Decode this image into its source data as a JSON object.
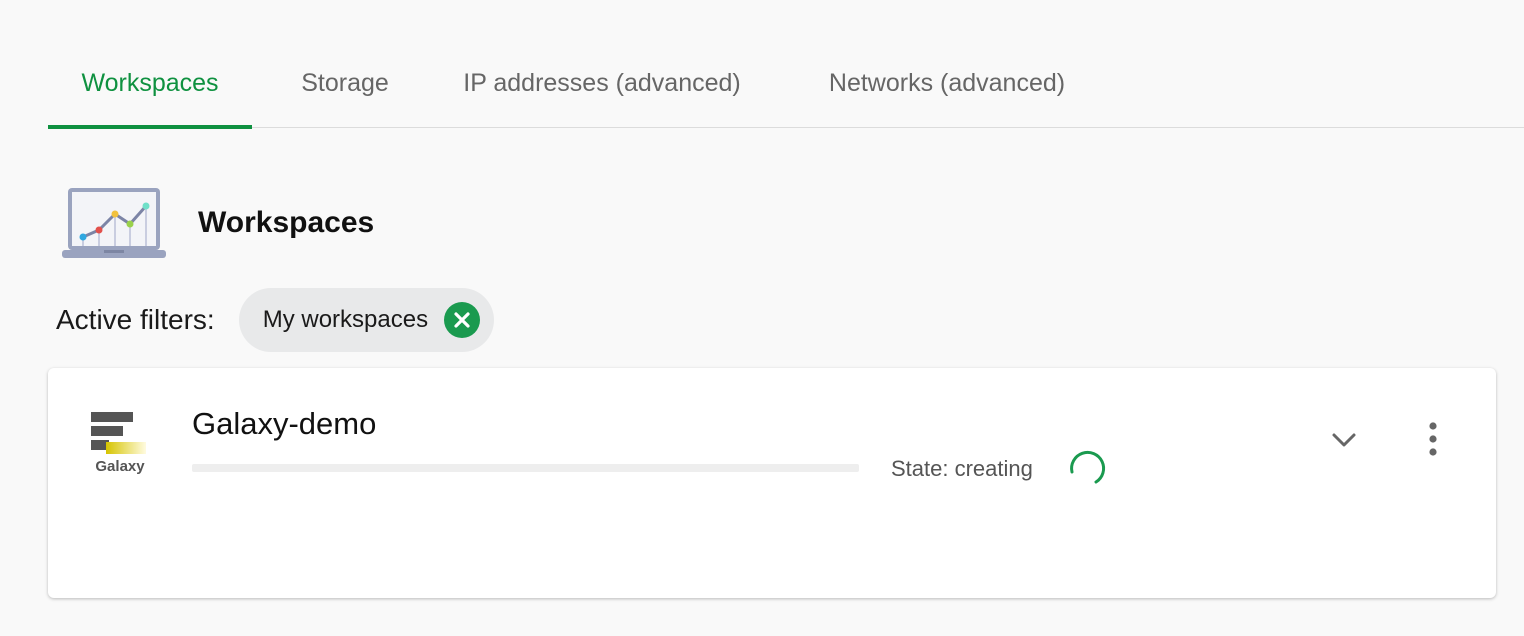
{
  "tabs": [
    {
      "label": "Workspaces",
      "active": true
    },
    {
      "label": "Storage",
      "active": false
    },
    {
      "label": "IP addresses (advanced)",
      "active": false
    },
    {
      "label": "Networks (advanced)",
      "active": false
    }
  ],
  "header": {
    "title": "Workspaces",
    "icon": "laptop-chart-icon"
  },
  "filters": {
    "label": "Active filters:",
    "chips": [
      {
        "label": "My workspaces",
        "icon": "close-circle-icon"
      }
    ]
  },
  "workspaces": [
    {
      "name": "Galaxy-demo",
      "logo_text": "Galaxy",
      "logo_icon": "galaxy-logo-icon",
      "state_text": "State: creating",
      "progress": 0,
      "actions": [
        "chevron-down-icon",
        "more-vertical-icon"
      ]
    }
  ],
  "colors": {
    "accent": "#0f9140",
    "chip_bg": "#e8e9ea",
    "page_bg": "#f9f9f9"
  }
}
